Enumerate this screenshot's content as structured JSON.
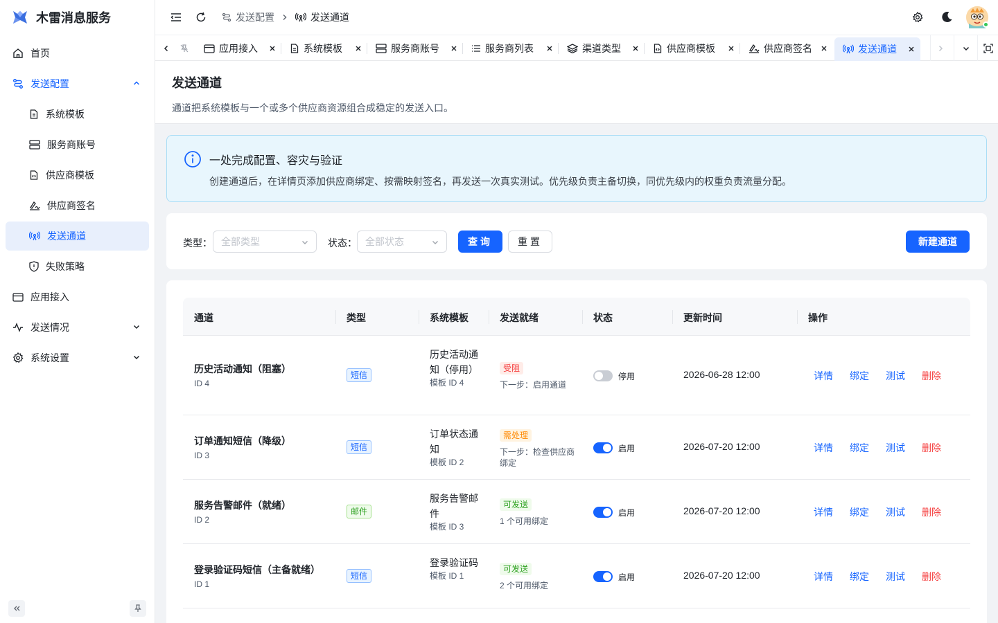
{
  "app": {
    "title": "木雷消息服务"
  },
  "sidebar": {
    "items": [
      {
        "label": "首页"
      },
      {
        "label": "发送配置"
      },
      {
        "label": "系统模板"
      },
      {
        "label": "服务商账号"
      },
      {
        "label": "供应商模板"
      },
      {
        "label": "供应商签名"
      },
      {
        "label": "发送通道"
      },
      {
        "label": "失败策略"
      },
      {
        "label": "应用接入"
      },
      {
        "label": "发送情况"
      },
      {
        "label": "系统设置"
      }
    ]
  },
  "breadcrumb": {
    "parent": "发送配置",
    "current": "发送通道"
  },
  "tabs": [
    {
      "label": "应用接入"
    },
    {
      "label": "系统模板"
    },
    {
      "label": "服务商账号"
    },
    {
      "label": "服务商列表"
    },
    {
      "label": "渠道类型"
    },
    {
      "label": "供应商模板"
    },
    {
      "label": "供应商签名"
    },
    {
      "label": "发送通道"
    }
  ],
  "page": {
    "title": "发送通道",
    "description": "通道把系统模板与一个或多个供应商资源组合成稳定的发送入口。"
  },
  "alert": {
    "title": "一处完成配置、容灾与验证",
    "body": "创建通道后，在详情页添加供应商绑定、按需映射签名，再发送一次真实测试。优先级负责主备切换，同优先级内的权重负责流量分配。"
  },
  "filter": {
    "type_label": "类型",
    "type_placeholder": "全部类型",
    "status_label": "状态",
    "status_placeholder": "全部状态",
    "query": "查询",
    "reset": "重置",
    "create": "新建通道"
  },
  "table": {
    "columns": [
      "通道",
      "类型",
      "系统模板",
      "发送就绪",
      "状态",
      "更新时间",
      "操作"
    ],
    "actions": {
      "detail": "详情",
      "bind": "绑定",
      "test": "测试",
      "delete": "删除"
    },
    "rows": [
      {
        "name": "历史活动通知（阻塞）",
        "id": "ID 4",
        "type": "短信",
        "tpl": "历史活动通知（停用）",
        "tpl_id": "模板 ID 4",
        "ready": "受阻",
        "ready_note": "下一步：启用通道",
        "enabled": false,
        "status": "停用",
        "time": "2026-06-28 12:00"
      },
      {
        "name": "订单通知短信（降级）",
        "id": "ID 3",
        "type": "短信",
        "tpl": "订单状态通知",
        "tpl_id": "模板 ID 2",
        "ready": "需处理",
        "ready_note": "下一步：检查供应商绑定",
        "enabled": true,
        "status": "启用",
        "time": "2026-07-20 12:00"
      },
      {
        "name": "服务告警邮件（就绪）",
        "id": "ID 2",
        "type": "邮件",
        "tpl": "服务告警邮件",
        "tpl_id": "模板 ID 3",
        "ready": "可发送",
        "ready_note": "1 个可用绑定",
        "enabled": true,
        "status": "启用",
        "time": "2026-07-20 12:00"
      },
      {
        "name": "登录验证码短信（主备就绪）",
        "id": "ID 1",
        "type": "短信",
        "tpl": "登录验证码",
        "tpl_id": "模板 ID 1",
        "ready": "可发送",
        "ready_note": "2 个可用绑定",
        "enabled": true,
        "status": "启用",
        "time": "2026-07-20 12:00"
      }
    ]
  }
}
